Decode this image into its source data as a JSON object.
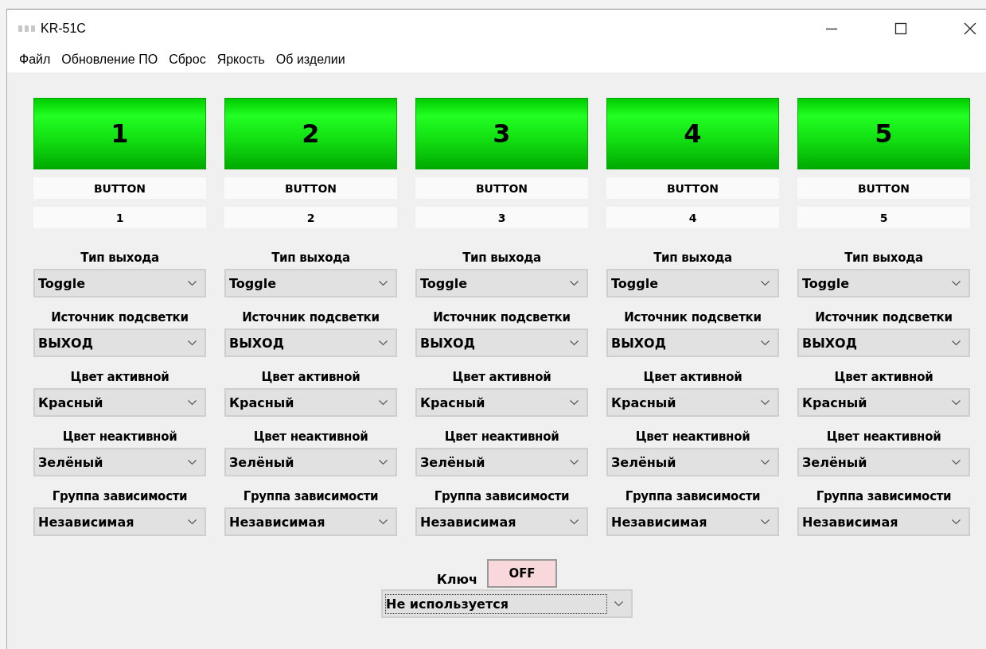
{
  "window": {
    "title": "KR-51C"
  },
  "menu": [
    "Файл",
    "Обновление ПО",
    "Сброс",
    "Яркость",
    "Об изделии"
  ],
  "channels": [
    {
      "number": "1",
      "type": "BUTTON",
      "index": "1",
      "fields": [
        {
          "label": "Тип выхода",
          "value": "Toggle"
        },
        {
          "label": "Источник подсветки",
          "value": "ВЫХОД"
        },
        {
          "label": "Цвет активной",
          "value": "Красный"
        },
        {
          "label": "Цвет неактивной",
          "value": "Зелёный"
        },
        {
          "label": "Группа зависимости",
          "value": "Независимая"
        }
      ]
    },
    {
      "number": "2",
      "type": "BUTTON",
      "index": "2",
      "fields": [
        {
          "label": "Тип выхода",
          "value": "Toggle"
        },
        {
          "label": "Источник подсветки",
          "value": "ВЫХОД"
        },
        {
          "label": "Цвет активной",
          "value": "Красный"
        },
        {
          "label": "Цвет неактивной",
          "value": "Зелёный"
        },
        {
          "label": "Группа зависимости",
          "value": "Независимая"
        }
      ]
    },
    {
      "number": "3",
      "type": "BUTTON",
      "index": "3",
      "fields": [
        {
          "label": "Тип выхода",
          "value": "Toggle"
        },
        {
          "label": "Источник подсветки",
          "value": "ВЫХОД"
        },
        {
          "label": "Цвет активной",
          "value": "Красный"
        },
        {
          "label": "Цвет неактивной",
          "value": "Зелёный"
        },
        {
          "label": "Группа зависимости",
          "value": "Независимая"
        }
      ]
    },
    {
      "number": "4",
      "type": "BUTTON",
      "index": "4",
      "fields": [
        {
          "label": "Тип выхода",
          "value": "Toggle"
        },
        {
          "label": "Источник подсветки",
          "value": "ВЫХОД"
        },
        {
          "label": "Цвет активной",
          "value": "Красный"
        },
        {
          "label": "Цвет неактивной",
          "value": "Зелёный"
        },
        {
          "label": "Группа зависимости",
          "value": "Независимая"
        }
      ]
    },
    {
      "number": "5",
      "type": "BUTTON",
      "index": "5",
      "fields": [
        {
          "label": "Тип выхода",
          "value": "Toggle"
        },
        {
          "label": "Источник подсветки",
          "value": "ВЫХОД"
        },
        {
          "label": "Цвет активной",
          "value": "Красный"
        },
        {
          "label": "Цвет неактивной",
          "value": "Зелёный"
        },
        {
          "label": "Группа зависимости",
          "value": "Независимая"
        }
      ]
    }
  ],
  "key": {
    "label": "Ключ",
    "state": "OFF",
    "on": false,
    "mode": {
      "value": "Не используется",
      "focused": true
    }
  }
}
